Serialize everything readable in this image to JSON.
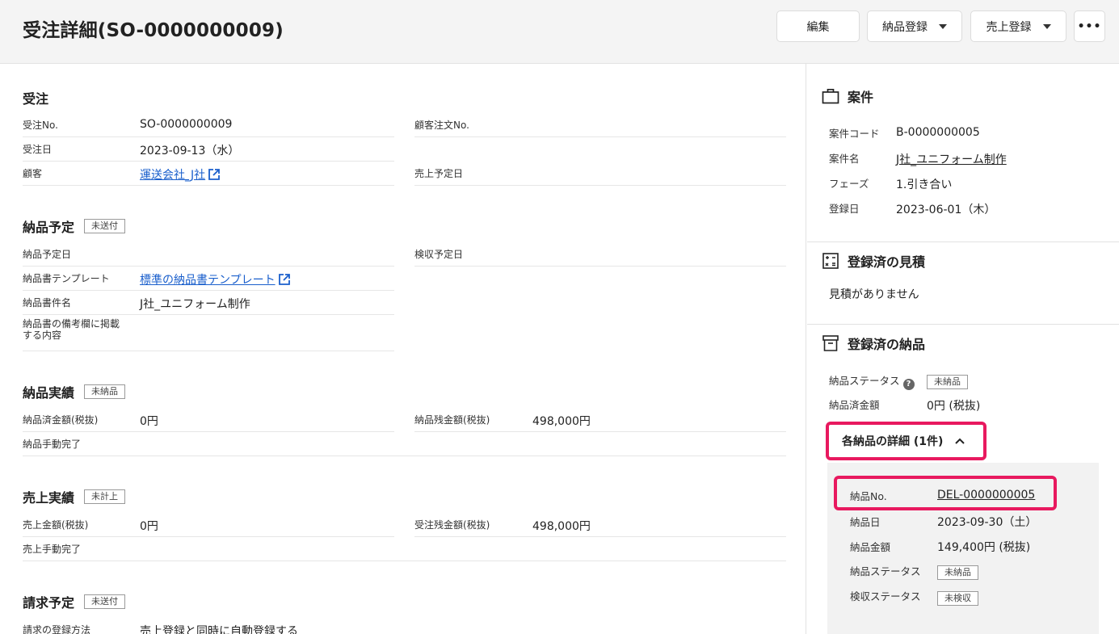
{
  "header": {
    "title": "受注詳細(SO-0000000009)",
    "buttons": {
      "edit": "編集",
      "delivery": "納品登録",
      "sales": "売上登録",
      "more": "•••"
    }
  },
  "order": {
    "title": "受注",
    "no_label": "受注No.",
    "no_value": "SO-0000000009",
    "customer_order_label": "顧客注文No.",
    "date_label": "受注日",
    "date_value": "2023-09-13（水）",
    "customer_label": "顧客",
    "customer_value": "運送会社_J社",
    "sales_date_label": "売上予定日"
  },
  "delivery_plan": {
    "title": "納品予定",
    "badge": "未送付",
    "date_label": "納品予定日",
    "inspect_label": "検収予定日",
    "template_label": "納品書テンプレート",
    "template_value": "標準の納品書テンプレート",
    "doc_name_label": "納品書件名",
    "doc_name_value": "J社_ユニフォーム制作",
    "note_label_1": "納品書の備考欄に掲載",
    "note_label_2": "する内容"
  },
  "delivery_actual": {
    "title": "納品実績",
    "badge": "未納品",
    "done_label": "納品済金額(税抜)",
    "done_value": "0円",
    "remain_label": "納品残金額(税抜)",
    "remain_value": "498,000円",
    "manual_label": "納品手動完了"
  },
  "sales_actual": {
    "title": "売上実績",
    "badge": "未計上",
    "amount_label": "売上金額(税抜)",
    "amount_value": "0円",
    "remain_label": "受注残金額(税抜)",
    "remain_value": "498,000円",
    "manual_label": "売上手動完了"
  },
  "billing_plan": {
    "title": "請求予定",
    "badge": "未送付",
    "method_label": "請求の登録方法",
    "method_value": "売上登録と同時に自動登録する"
  },
  "side": {
    "project": {
      "title": "案件",
      "code_label": "案件コード",
      "code_value": "B-0000000005",
      "name_label": "案件名",
      "name_value": "J社_ユニフォーム制作",
      "phase_label": "フェーズ",
      "phase_value": "1.引き合い",
      "reg_label": "登録日",
      "reg_value": "2023-06-01（木）"
    },
    "quotes": {
      "title": "登録済の見積",
      "empty": "見積がありません"
    },
    "deliveries": {
      "title": "登録済の納品",
      "status_label": "納品ステータス",
      "status_value": "未納品",
      "help": "?",
      "amount_label": "納品済金額",
      "amount_value": "0円 (税抜)",
      "toggle_label": "各納品の詳細 (1件)",
      "detail": {
        "no_label": "納品No.",
        "no_value": "DEL-0000000005",
        "date_label": "納品日",
        "date_value": "2023-09-30（土）",
        "amount_label": "納品金額",
        "amount_value": "149,400円 (税抜)",
        "status_label": "納品ステータス",
        "status_value": "未納品",
        "inspect_label": "検収ステータス",
        "inspect_value": "未検収"
      }
    }
  },
  "colors": {
    "link": "#1a5fcc",
    "highlight": "#e8195f"
  }
}
